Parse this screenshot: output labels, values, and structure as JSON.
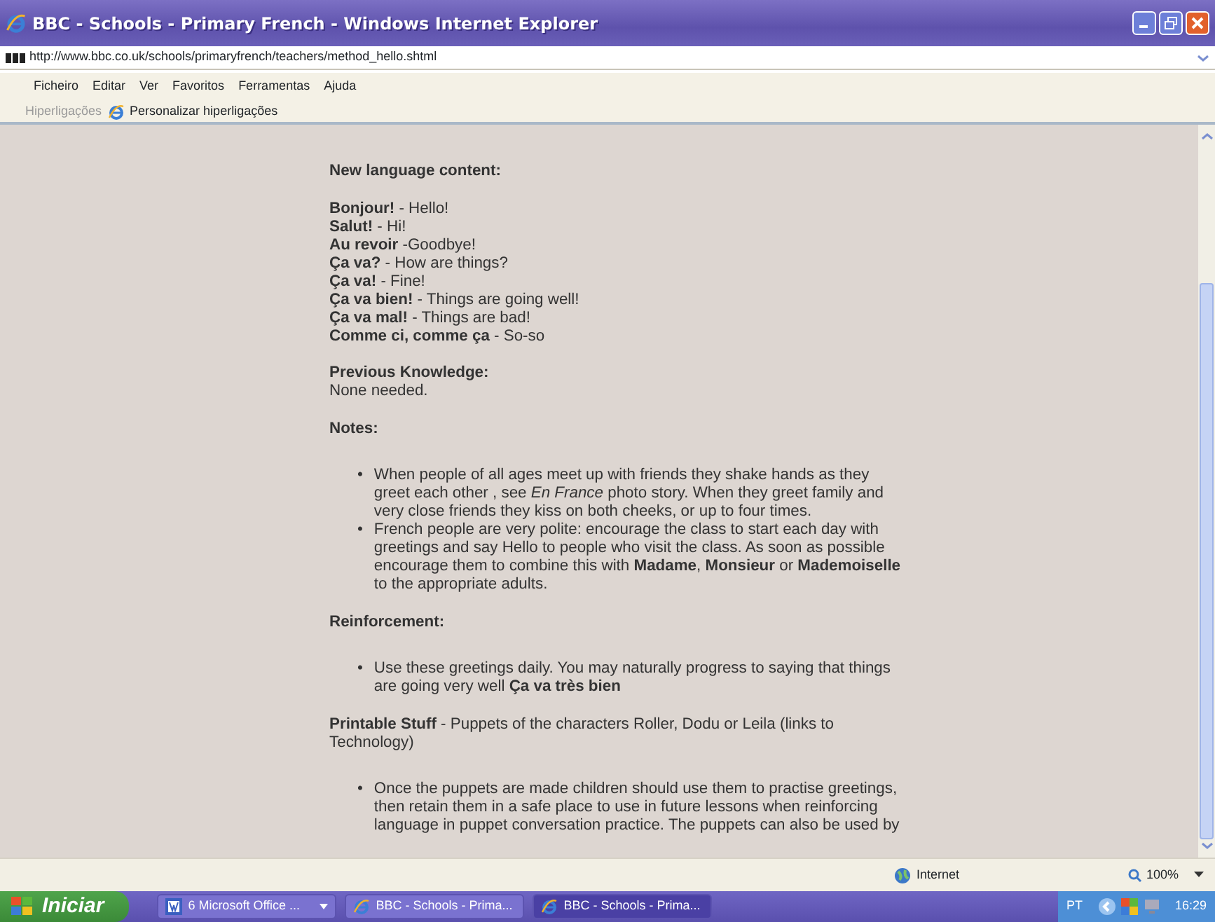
{
  "window": {
    "title": "BBC - Schools - Primary French - Windows Internet Explorer"
  },
  "address": {
    "url": "http://www.bbc.co.uk/schools/primaryfrench/teachers/method_hello.shtml"
  },
  "menu": [
    "Ficheiro",
    "Editar",
    "Ver",
    "Favoritos",
    "Ferramentas",
    "Ajuda"
  ],
  "links_bar": {
    "label": "Hiperligações",
    "item": "Personalizar hiperligações"
  },
  "content": [
    {
      "kind": "heading",
      "text": "New language content:"
    },
    {
      "kind": "lines",
      "items": [
        "**Bonjour!** - Hello!",
        "**Salut!** - Hi!",
        "**Au revoir** -Goodbye!",
        "**Ça va?** - How are things?",
        "**Ça va!** - Fine!",
        "**Ça va bien!** - Things are going well!",
        "**Ça va mal!** - Things are bad!",
        "**Comme ci, comme ça** - So-so"
      ]
    },
    {
      "kind": "heading_text",
      "heading": "Previous Knowledge:",
      "text": "None needed."
    },
    {
      "kind": "heading",
      "text": "Notes:"
    },
    {
      "kind": "bullets",
      "marker": "•",
      "items": [
        "When people of all ages meet up with friends they shake hands as they greet each other , see *En France* photo story. When they greet family and very close friends they kiss on both cheeks, or up to four times.",
        "French people are very polite: encourage the class to start each day with greetings and say Hello to people who visit the class. As soon as possible encourage them to combine this with **Madame**, **Monsieur** or **Mademoiselle** to the appropriate adults."
      ]
    },
    {
      "kind": "heading",
      "text": "Reinforcement:"
    },
    {
      "kind": "bullets",
      "marker": "•",
      "items": [
        "Use these greetings daily. You may naturally progress to saying that things are going very well **Ça va très bien**"
      ]
    },
    {
      "kind": "paragraph",
      "text": "**Printable Stuff** - Puppets of the characters Roller, Dodu or Leila (links to Technology)"
    },
    {
      "kind": "bullets",
      "marker": "•",
      "items": [
        "Once the puppets are made children should use them to practise greetings, then retain them in a safe place to use in future lessons when reinforcing language in puppet conversation practice. The puppets can also be used by"
      ]
    }
  ],
  "status_bar": {
    "zone": "Internet",
    "zoom": "100%"
  },
  "taskbar": {
    "start": "Iniciar",
    "tasks": [
      {
        "label": "6 Microsoft Office ...",
        "kind": "word",
        "selected": false
      },
      {
        "label": "BBC - Schools - Prima...",
        "kind": "ie",
        "selected": false
      },
      {
        "label": "BBC - Schools - Prima...",
        "kind": "ie",
        "selected": true
      }
    ],
    "language": "PT",
    "clock": "16:29"
  }
}
